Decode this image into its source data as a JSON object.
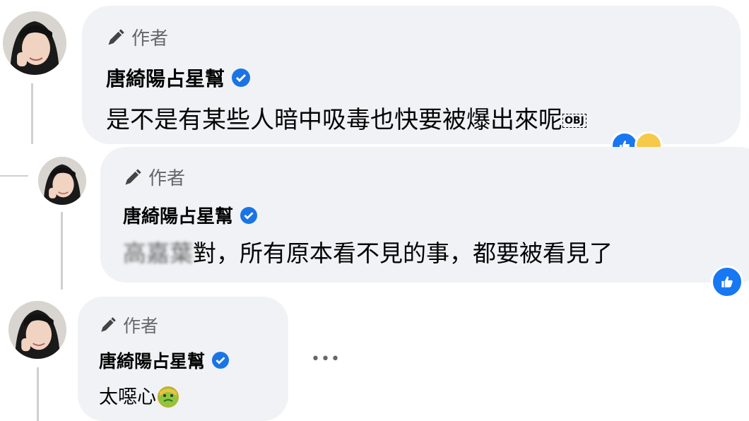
{
  "comments": [
    {
      "author_badge": "作者",
      "name": "唐綺陽占星幫",
      "text": "是不是有某些人暗中吸毒也快要被爆出來呢",
      "trailing_glyph": "OBJ",
      "reactions": [
        "like-icon",
        "haha-icon"
      ]
    },
    {
      "author_badge": "作者",
      "name": "唐綺陽占星幫",
      "mention": "高嘉葉",
      "text": "對，所有原本看不見的事，都要被看見了",
      "reactions": [
        "like-icon"
      ]
    },
    {
      "author_badge": "作者",
      "name": "唐綺陽占星幫",
      "text": "太噁心",
      "emoji": "nauseated-face-emoji",
      "more_label": "•••"
    }
  ],
  "colors": {
    "bubble": "#f0f2f5",
    "verified": "#1b74e4",
    "like": "#1877f2",
    "muted": "#65676b",
    "thread_line": "#ced0d4"
  }
}
